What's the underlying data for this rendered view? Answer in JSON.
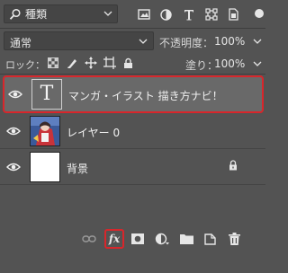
{
  "filter": {
    "kind_label": "種類",
    "icons": [
      "pixel-layer-filter-icon",
      "adjustment-layer-filter-icon",
      "type-layer-filter-icon",
      "shape-layer-filter-icon",
      "smart-object-filter-icon"
    ]
  },
  "blend": {
    "mode": "通常",
    "opacity_label": "不透明度：",
    "opacity_value": "100%"
  },
  "lock": {
    "label": "ロック：",
    "fill_label": "塗り：",
    "fill_value": "100%"
  },
  "layers": [
    {
      "name": "マンガ・イラスト 描き方ナビ！",
      "type": "text",
      "selected": true,
      "thumb_glyph": "T"
    },
    {
      "name": "レイヤー 0",
      "type": "image",
      "selected": false
    },
    {
      "name": "背景",
      "type": "background",
      "selected": false,
      "locked": true
    }
  ],
  "colors": {
    "panel_bg": "#535353",
    "selected_bg": "#696969",
    "highlight_red": "#d8262b"
  },
  "footer": {
    "fx_label": "fx"
  }
}
